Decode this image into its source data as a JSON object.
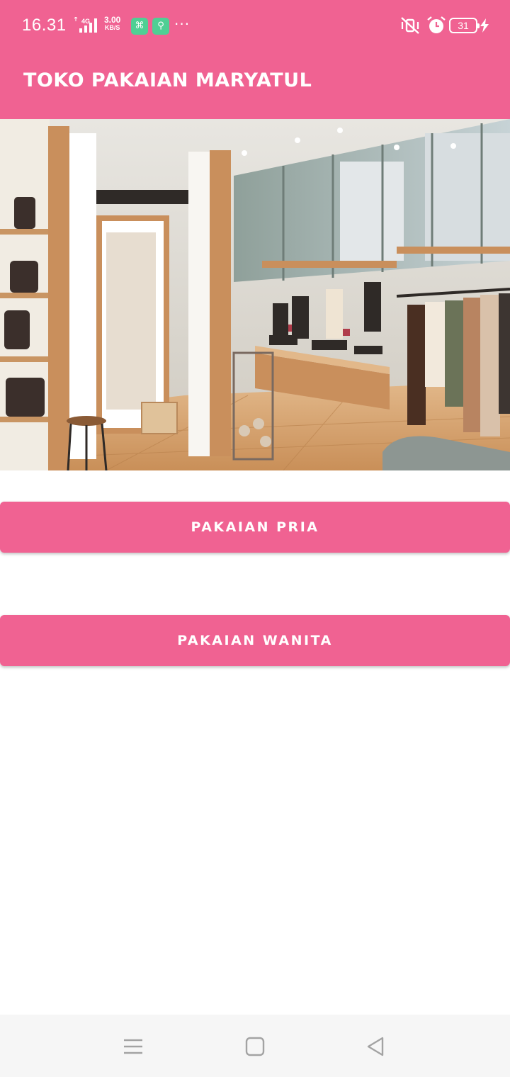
{
  "status_bar": {
    "time": "16.31",
    "network": "4G",
    "speed_value": "3.00",
    "speed_unit": "KB/S",
    "more": "···",
    "battery": "31",
    "icons": [
      "signal-icon",
      "app-notification-icon",
      "vpn-icon",
      "mute-icon",
      "alarm-icon",
      "battery-icon",
      "charging-icon"
    ]
  },
  "app_bar": {
    "title": "TOKO PAKAIAN MARYATUL"
  },
  "main": {
    "hero_image": "clothing-store-interior",
    "buttons": [
      {
        "label": "PAKAIAN PRIA"
      },
      {
        "label": "PAKAIAN WANITA"
      }
    ]
  },
  "nav_bar": {
    "icons": [
      "recent-apps-icon",
      "home-icon",
      "back-icon"
    ]
  },
  "colors": {
    "primary": "#f06292",
    "on_primary": "#ffffff",
    "background": "#ffffff",
    "nav_background": "#f6f6f6",
    "nav_icon": "#9e9e9e"
  }
}
